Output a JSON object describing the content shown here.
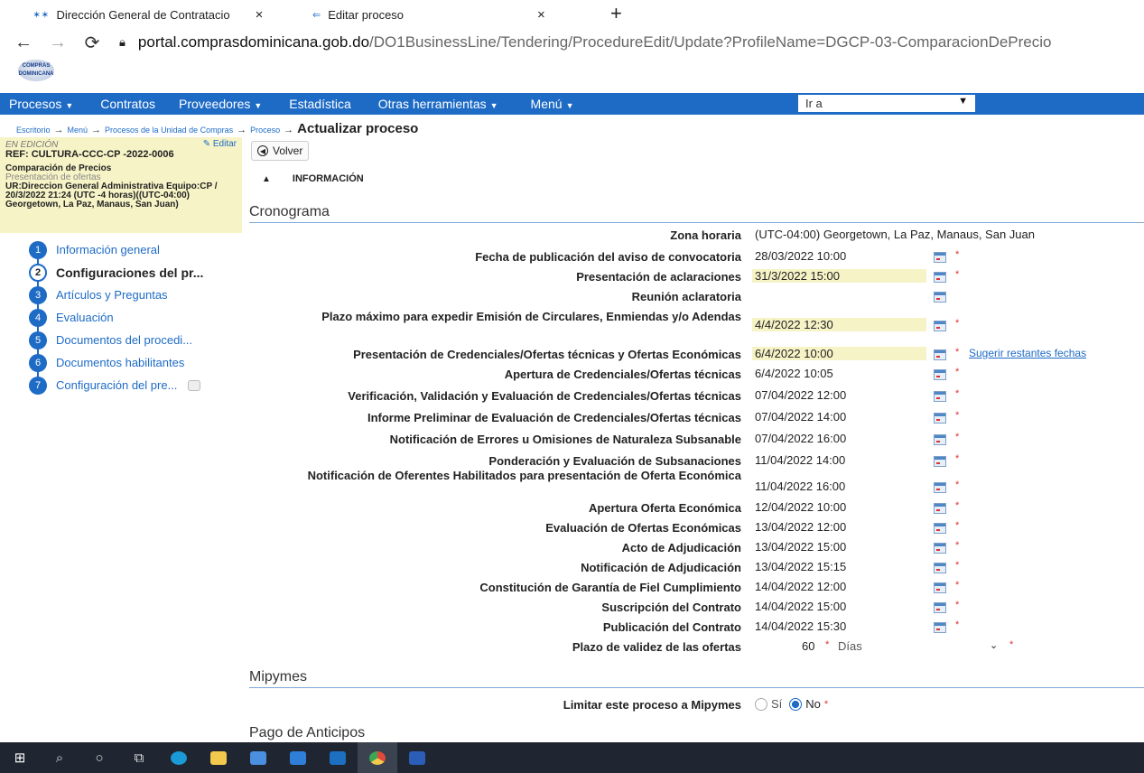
{
  "browser": {
    "tabs": [
      {
        "title": "Dirección General de Contratacio",
        "close": "×"
      },
      {
        "title": "Editar proceso",
        "close": "×"
      }
    ],
    "new_tab": "+",
    "url_host": "portal.comprasdominicana.gob.do",
    "url_path": "/DO1BusinessLine/Tendering/ProcedureEdit/Update?ProfileName=DGCP-03-ComparacionDePrecio"
  },
  "logo_text": "COMPRAS DOMINICANA",
  "menu": {
    "items": [
      {
        "label": "Procesos",
        "caret": true
      },
      {
        "label": "Contratos",
        "caret": false
      },
      {
        "label": "Proveedores",
        "caret": true
      },
      {
        "label": "Estadística",
        "caret": false
      },
      {
        "label": "Otras herramientas",
        "caret": true
      },
      {
        "label": "Menú",
        "caret": true
      }
    ],
    "goto_value": "Ir a"
  },
  "breadcrumb": {
    "items": [
      "Escritorio",
      "Menú",
      "Procesos de la Unidad de Compras",
      "Proceso"
    ],
    "current": "Actualizar proceso"
  },
  "infobox": {
    "status": "EN EDICIÓN",
    "edit": "Editar",
    "ref": "REF: CULTURA-CCC-CP -2022-0006",
    "title": "Comparación de Precios",
    "phase": "Presentación de ofertas",
    "ur": "UR:Direccion General Administrativa Equipo:CP / 20/3/2022 21:24 (UTC -4 horas)((UTC-04:00) Georgetown, La Paz, Manaus, San Juan)"
  },
  "steps": [
    {
      "num": "1",
      "label": "Información general",
      "active": false
    },
    {
      "num": "2",
      "label": "Configuraciones del pr...",
      "active": true
    },
    {
      "num": "3",
      "label": "Artículos y Preguntas",
      "active": false
    },
    {
      "num": "4",
      "label": "Evaluación",
      "active": false
    },
    {
      "num": "5",
      "label": "Documentos del procedi...",
      "active": false
    },
    {
      "num": "6",
      "label": "Documentos habilitantes",
      "active": false
    },
    {
      "num": "7",
      "label": "Configuración del pre...",
      "active": false
    }
  ],
  "volver": "Volver",
  "info_header": "INFORMACIÓN",
  "sections": {
    "cronograma": "Cronograma",
    "mipymes": "Mipymes",
    "anticipos": "Pago de Anticipos"
  },
  "schedule": [
    {
      "label": "Zona horaria",
      "value": "(UTC-04:00) Georgetown, La Paz, Manaus, San Juan",
      "hl": false,
      "cal": false,
      "req": false
    },
    {
      "label": "Fecha de publicación del aviso de convocatoria",
      "value": "28/03/2022 10:00",
      "hl": false,
      "cal": true,
      "req": true
    },
    {
      "label": "Presentación de aclaraciones",
      "value": "31/3/2022 15:00",
      "hl": true,
      "cal": true,
      "req": true
    },
    {
      "label": "Reunión aclaratoria",
      "value": "",
      "hl": false,
      "cal": true,
      "req": false
    },
    {
      "label": "Plazo máximo para expedir Emisión de Circulares, Enmiendas y/o Adendas",
      "value": "4/4/2022 12:30",
      "hl": true,
      "cal": true,
      "req": true
    },
    {
      "label": "Presentación de Credenciales/Ofertas técnicas y Ofertas Económicas",
      "value": "6/4/2022 10:00",
      "hl": true,
      "cal": true,
      "req": true
    },
    {
      "label": "Apertura de Credenciales/Ofertas técnicas",
      "value": "6/4/2022 10:05",
      "hl": false,
      "cal": true,
      "req": true
    },
    {
      "label": "Verificación, Validación y Evaluación de Credenciales/Ofertas técnicas",
      "value": "07/04/2022 12:00",
      "hl": false,
      "cal": true,
      "req": true
    },
    {
      "label": "Informe Preliminar de Evaluación de Credenciales/Ofertas técnicas",
      "value": "07/04/2022 14:00",
      "hl": false,
      "cal": true,
      "req": true
    },
    {
      "label": "Notificación de Errores u Omisiones de Naturaleza Subsanable",
      "value": "07/04/2022 16:00",
      "hl": false,
      "cal": true,
      "req": true
    },
    {
      "label": "Ponderación y Evaluación de Subsanaciones",
      "value": "11/04/2022 14:00",
      "hl": false,
      "cal": true,
      "req": true
    },
    {
      "label": "Notificación de Oferentes Habilitados para presentación de Oferta Económica",
      "value": "11/04/2022 16:00",
      "hl": false,
      "cal": true,
      "req": true
    },
    {
      "label": "Apertura Oferta Económica",
      "value": "12/04/2022 10:00",
      "hl": false,
      "cal": true,
      "req": true
    },
    {
      "label": "Evaluación de Ofertas Económicas",
      "value": "13/04/2022 12:00",
      "hl": false,
      "cal": true,
      "req": true
    },
    {
      "label": "Acto de Adjudicación",
      "value": "13/04/2022 15:00",
      "hl": false,
      "cal": true,
      "req": true
    },
    {
      "label": "Notificación de Adjudicación",
      "value": "13/04/2022 15:15",
      "hl": false,
      "cal": true,
      "req": true
    },
    {
      "label": "Constitución de Garantía de Fiel Cumplimiento",
      "value": "14/04/2022 12:00",
      "hl": false,
      "cal": true,
      "req": true
    },
    {
      "label": "Suscripción del Contrato",
      "value": "14/04/2022 15:00",
      "hl": false,
      "cal": true,
      "req": true
    },
    {
      "label": "Publicación del Contrato",
      "value": "14/04/2022 15:30",
      "hl": false,
      "cal": true,
      "req": true
    }
  ],
  "suggest_link": "Sugerir restantes fechas",
  "validity": {
    "label": "Plazo de validez de las ofertas",
    "value": "60",
    "unit": "Días"
  },
  "mipymes": {
    "label": "Limitar este proceso a Mipymes",
    "opt_si": "Sí",
    "opt_no": "No",
    "selected": "No"
  },
  "required_mark": "*"
}
